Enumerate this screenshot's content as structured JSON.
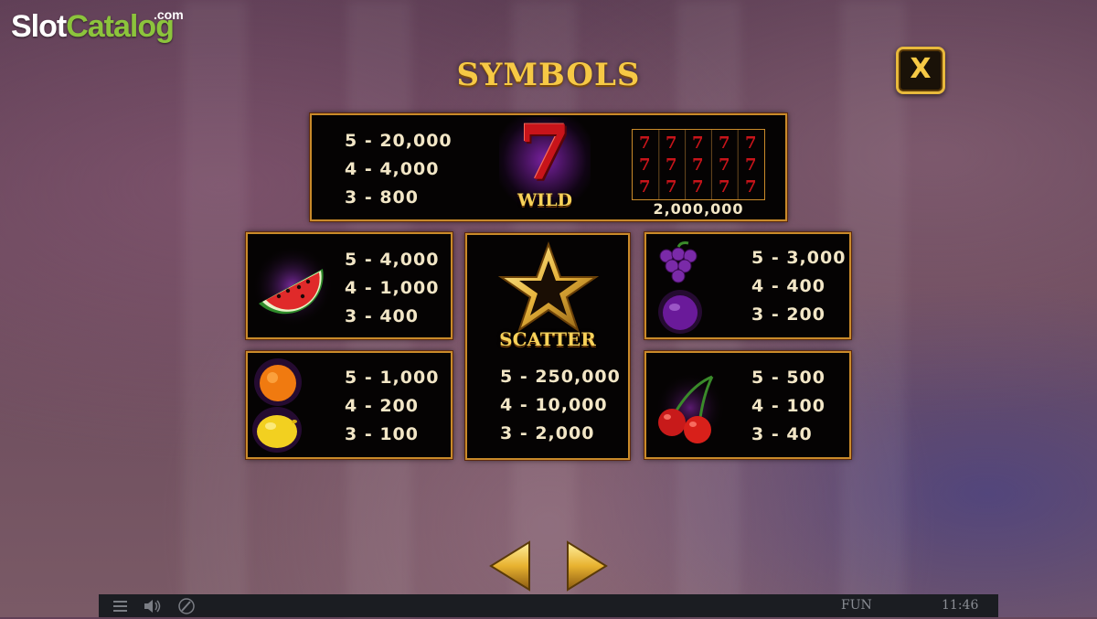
{
  "logo": {
    "part1": "Slot",
    "part2": "Catalog",
    "suffix": ".com"
  },
  "title": "SYMBOLS",
  "close_label": "X",
  "wild": {
    "pays": [
      "5 - 20,000",
      "4 - 4,000",
      "3 - 800"
    ],
    "label": "WILD",
    "symbol_glyph": "7",
    "grid_symbol": "7",
    "jackpot": "2,000,000"
  },
  "watermelon": {
    "pays": [
      "5 - 4,000",
      "4 - 1,000",
      "3 - 400"
    ]
  },
  "scatter": {
    "label": "SCATTER",
    "pays": [
      "5 - 250,000",
      "4 - 10,000",
      "3 - 2,000"
    ]
  },
  "grape_plum": {
    "pays": [
      "5 - 3,000",
      "4 - 400",
      "3 - 200"
    ]
  },
  "orange_lemon": {
    "pays": [
      "5 - 1,000",
      "4 - 200",
      "3 - 100"
    ]
  },
  "cherry": {
    "pays": [
      "5 - 500",
      "4 - 100",
      "3 - 40"
    ]
  },
  "status": {
    "mode": "FUN",
    "time": "11:46"
  },
  "icons": [
    "menu-icon",
    "speaker-icon",
    "quick-spin-icon",
    "arrow-left-icon",
    "arrow-right-icon",
    "close-icon"
  ],
  "colors": {
    "gold": "#f6c945",
    "panel_border": "#c98a2a",
    "panel_bg": "#050303",
    "pay_text": "#f2e6c6"
  }
}
